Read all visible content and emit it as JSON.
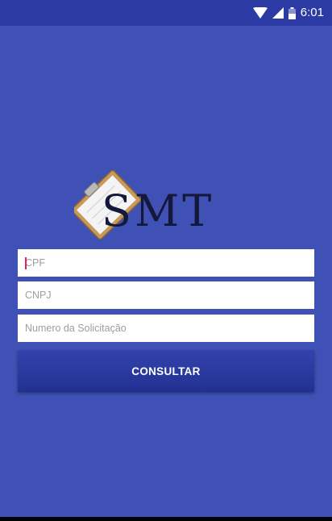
{
  "status_bar": {
    "time": "6:01",
    "icons": [
      "wifi-icon",
      "signal-icon",
      "battery-icon"
    ]
  },
  "logo": {
    "text": "SMT",
    "icon": "clipboard-icon"
  },
  "form": {
    "cpf_placeholder": "CPF",
    "cnpj_placeholder": "CNPJ",
    "solicitacao_placeholder": "Numero da Solicitação",
    "submit_label": "CONSULTAR"
  },
  "colors": {
    "background": "#3f51b5",
    "status_bar": "#2b3ba3",
    "button": "#26359a",
    "cursor": "#e91e63"
  }
}
